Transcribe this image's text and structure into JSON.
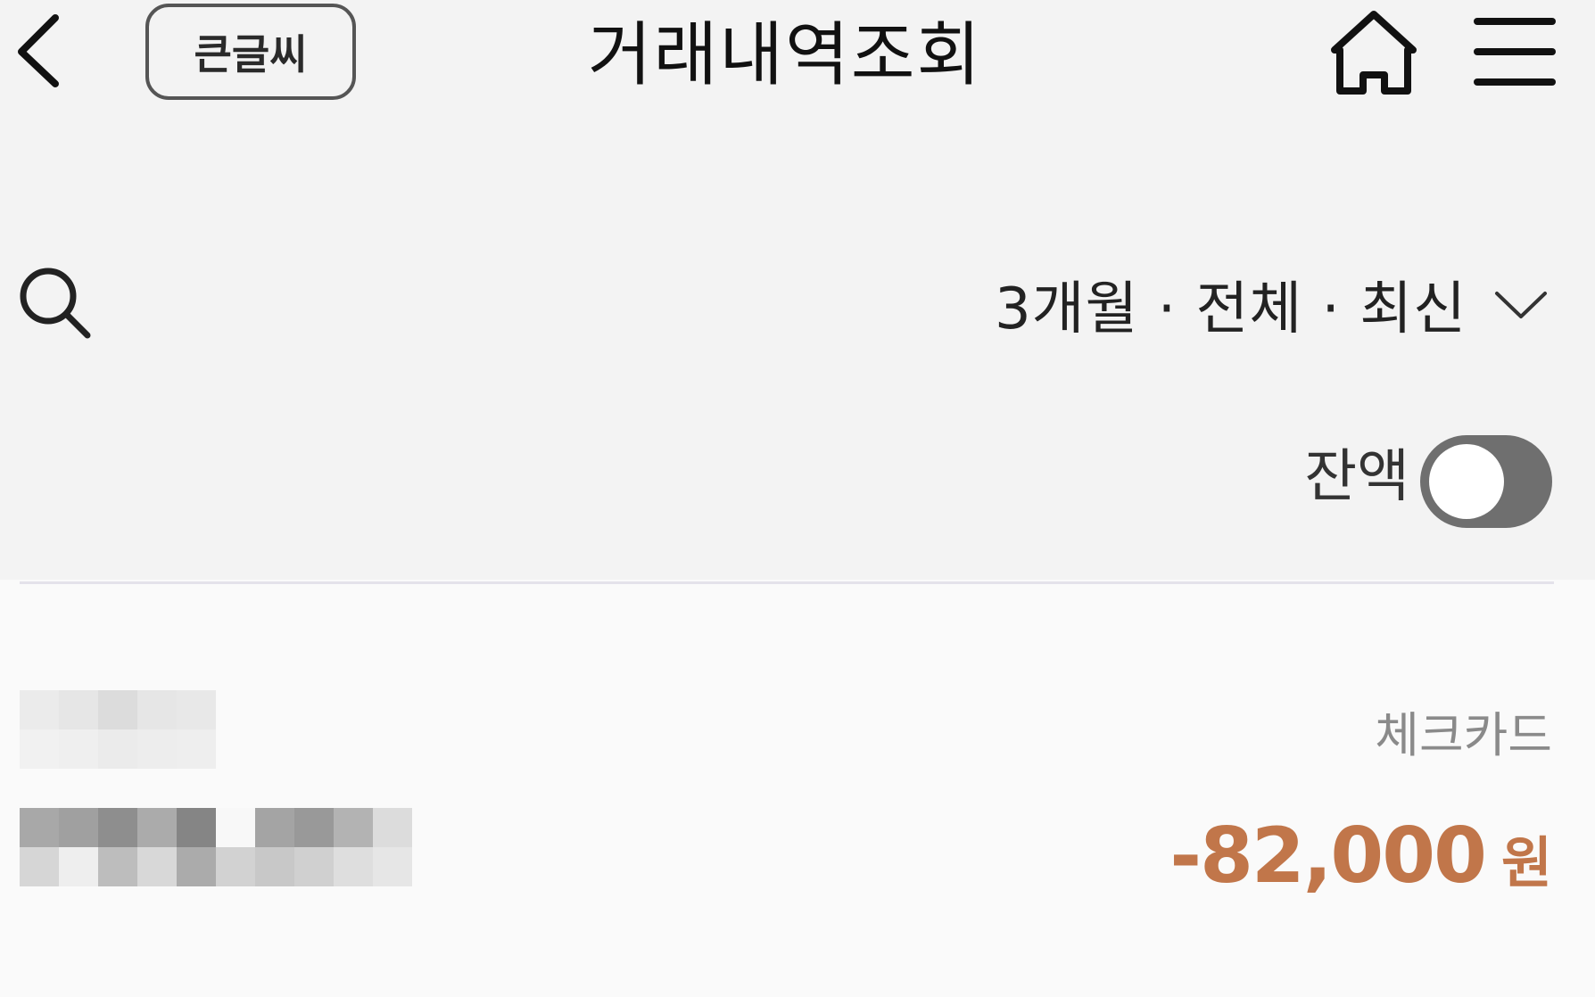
{
  "header": {
    "big_text_label": "큰글씨",
    "title": "거래내역조회"
  },
  "filter": {
    "summary": "3개월 · 전체 · 최신"
  },
  "balance": {
    "label": "잔액",
    "enabled": false
  },
  "transactions": [
    {
      "name": "",
      "type": "체크카드",
      "amount": "-82,000",
      "currency": "원"
    }
  ],
  "colors": {
    "amount": "#c1764a",
    "toggle_off": "#6f6f6f",
    "background": "#f3f3f3"
  },
  "icons": {
    "back": "chevron-left-icon",
    "home": "home-icon",
    "menu": "hamburger-menu-icon",
    "search": "search-icon",
    "dropdown": "chevron-down-icon"
  }
}
